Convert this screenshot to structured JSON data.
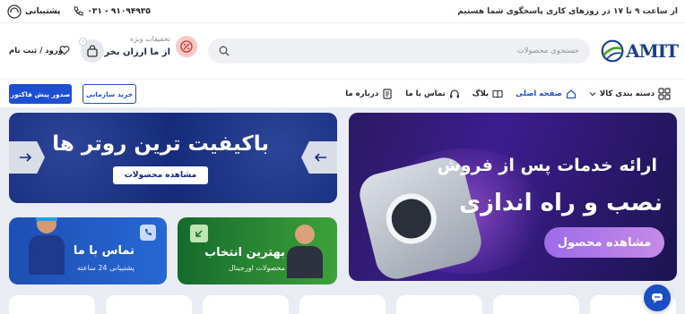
{
  "topbar": {
    "hours": "از ساعت ۹ تا ۱۷ در روزهای کاری پاسخگوی شما هستیم",
    "phone": "۰۳۱ - ۹۱۰۹۴۹۳۵",
    "support": "پشتیبانی"
  },
  "header": {
    "logo_text": "AMIT",
    "search_placeholder": "جستجوی محصولات",
    "deals_title": "تخفیفات ویژه",
    "deals_subtitle": "از ما ارزان بخر",
    "cart_count": "۰",
    "login": "ورود / ثبت نام"
  },
  "nav": {
    "items": [
      {
        "label": "دسته بندی کالا"
      },
      {
        "label": "صفحه اصلی"
      },
      {
        "label": "بلاگ"
      },
      {
        "label": "تماس با ما"
      },
      {
        "label": "درباره ما"
      }
    ],
    "org_button": "خرید سازمانی",
    "invoice_button": "صدور پیش فاکتور"
  },
  "banners": {
    "main": {
      "line1": "ارائه خدمات پس از فروش",
      "line2": "نصب و راه اندازی",
      "cta": "مشاهده محصول"
    },
    "router": {
      "title": "باکیفیت ترین روتر ها",
      "cta": "مشاهده محصولات"
    },
    "best": {
      "title": "بهترین انتخاب",
      "subtitle": "محصولات اورجینال"
    },
    "contact": {
      "title": "تماس با ما",
      "subtitle": "پشتیبانی 24 ساعته"
    }
  },
  "colors": {
    "primary": "#1d4fd0",
    "brand_green": "#47a52c",
    "brand_blue": "#1a3d8f"
  }
}
